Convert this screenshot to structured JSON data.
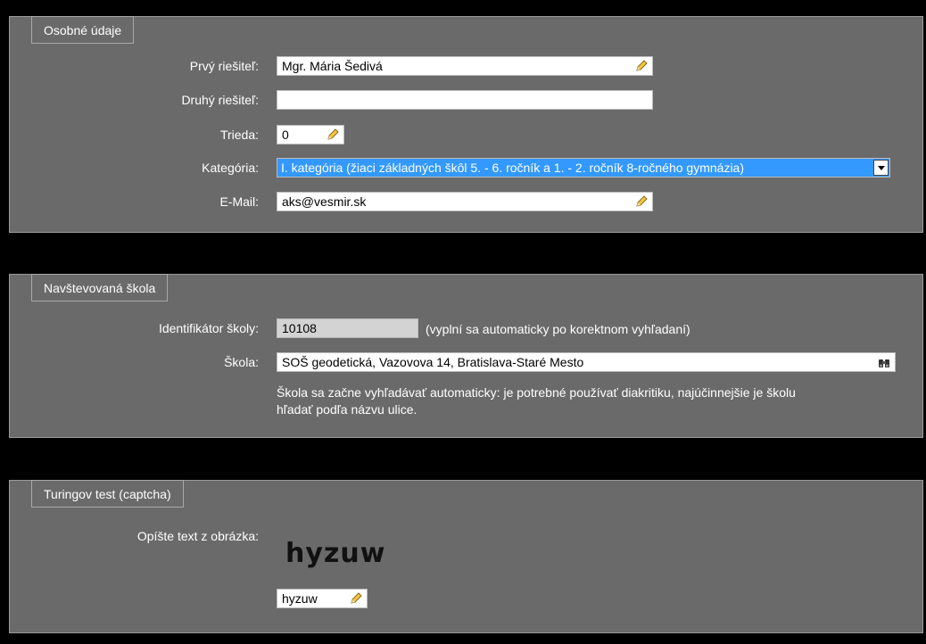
{
  "personal": {
    "legend": "Osobné údaje",
    "first_solver_label": "Prvý riešiteľ:",
    "first_solver_value": "Mgr. Mária Šedivá",
    "second_solver_label": "Druhý riešiteľ:",
    "second_solver_value": "",
    "class_label": "Trieda:",
    "class_value": "0",
    "category_label": "Kategória:",
    "category_value": "I. kategória (žiaci základných škôl 5. - 6. ročník a 1. - 2. ročník 8-ročného gymnázia)",
    "email_label": "E-Mail:",
    "email_value": "aks@vesmir.sk"
  },
  "school": {
    "legend": "Navštevovaná škola",
    "id_label": "Identifikátor školy:",
    "id_value": "10108",
    "id_hint": "(vyplní sa automaticky po korektnom vyhľadaní)",
    "school_label": "Škola:",
    "school_value": "SOŠ geodetická, Vazovova 14, Bratislava-Staré Mesto",
    "note_line1": "Škola sa začne vyhľadávať automaticky: je potrebné používať diakritiku, najúčinnejšie je školu",
    "note_line2": "hľadať podľa názvu ulice."
  },
  "captcha": {
    "legend": "Turingov test (captcha)",
    "label": "Opíšte text z obrázka:",
    "image_text": "hyzuw",
    "input_value": "hyzuw"
  },
  "colors": {
    "panel": "#6a6a6a",
    "background": "#000000",
    "select_highlight": "#3399ff"
  }
}
